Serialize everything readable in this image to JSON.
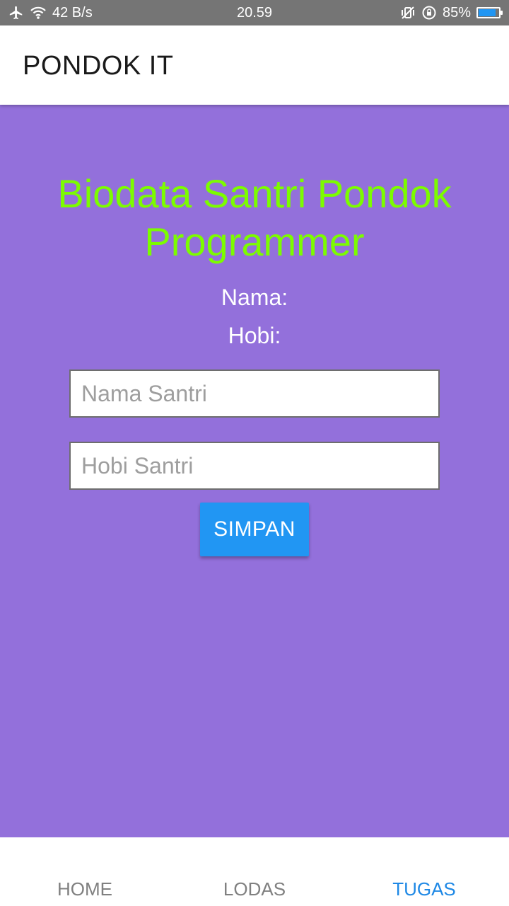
{
  "status_bar": {
    "network_speed": "42 B/s",
    "time": "20.59",
    "battery_percent": "85%",
    "battery_level": 0.85,
    "icons": [
      "airplane-mode-icon",
      "wifi-icon",
      "vibrate-icon",
      "rotation-lock-icon",
      "battery-icon"
    ]
  },
  "app_bar": {
    "title": "PONDOK IT"
  },
  "main": {
    "background_color": "#9370db",
    "headline": "Biodata Santri Pondok Programmer",
    "headline_color": "#7cfc00",
    "nama_label": "Nama:",
    "hobi_label": "Hobi:",
    "nama_input": {
      "value": "",
      "placeholder": "Nama Santri"
    },
    "hobi_input": {
      "value": "",
      "placeholder": "Hobi Santri"
    },
    "save_label": "SIMPAN",
    "button_color": "#2196f3"
  },
  "tabs": [
    {
      "label": "HOME",
      "active": false
    },
    {
      "label": "LODAS",
      "active": false
    },
    {
      "label": "TUGAS",
      "active": true
    }
  ],
  "active_tab_color": "#1e88e5"
}
